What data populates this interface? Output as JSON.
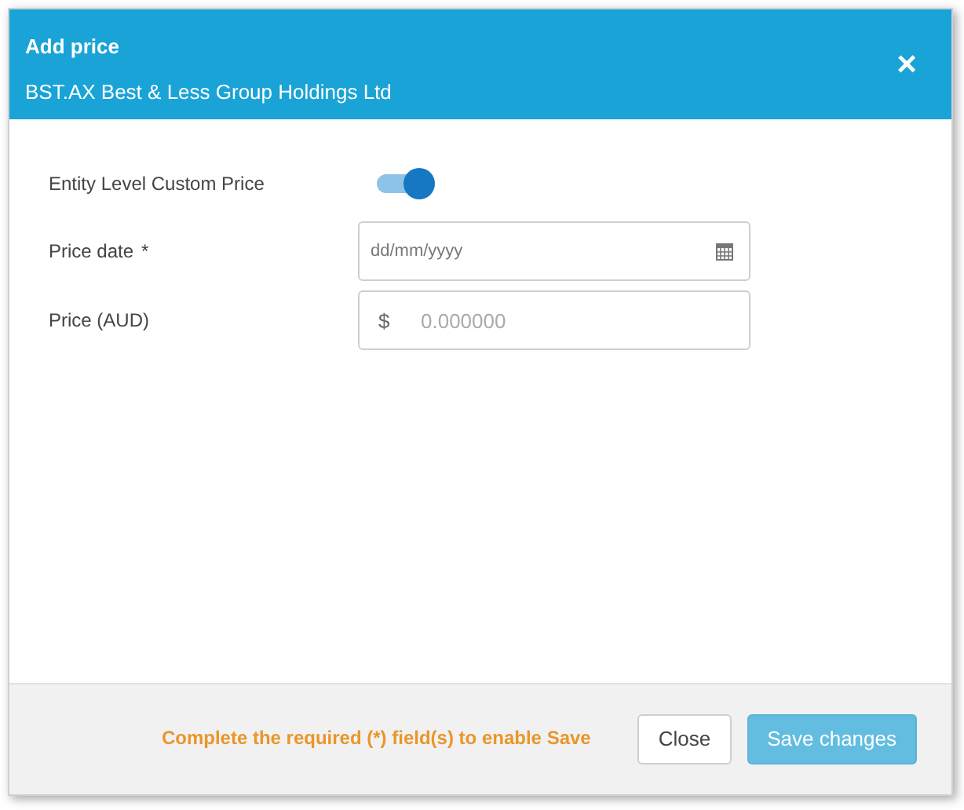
{
  "dialog": {
    "title": "Add price",
    "subtitle": "BST.AX Best & Less Group Holdings Ltd",
    "close_icon": "×"
  },
  "fields": [
    {
      "kind": "toggle",
      "label": "Entity Level Custom Price",
      "on": true
    },
    {
      "kind": "date",
      "label": "Price date",
      "required_mark": "*",
      "placeholder": "dd/mm/yyyy"
    },
    {
      "kind": "currency",
      "label": "Price (AUD)",
      "prefix": "$",
      "placeholder": "0.000000"
    }
  ],
  "footer": {
    "message": "Complete the required (*) field(s) to enable Save",
    "buttons": [
      {
        "label": "Close",
        "kind": "secondary",
        "disabled": false
      },
      {
        "label": "Save changes",
        "kind": "primary",
        "disabled": true
      }
    ]
  }
}
